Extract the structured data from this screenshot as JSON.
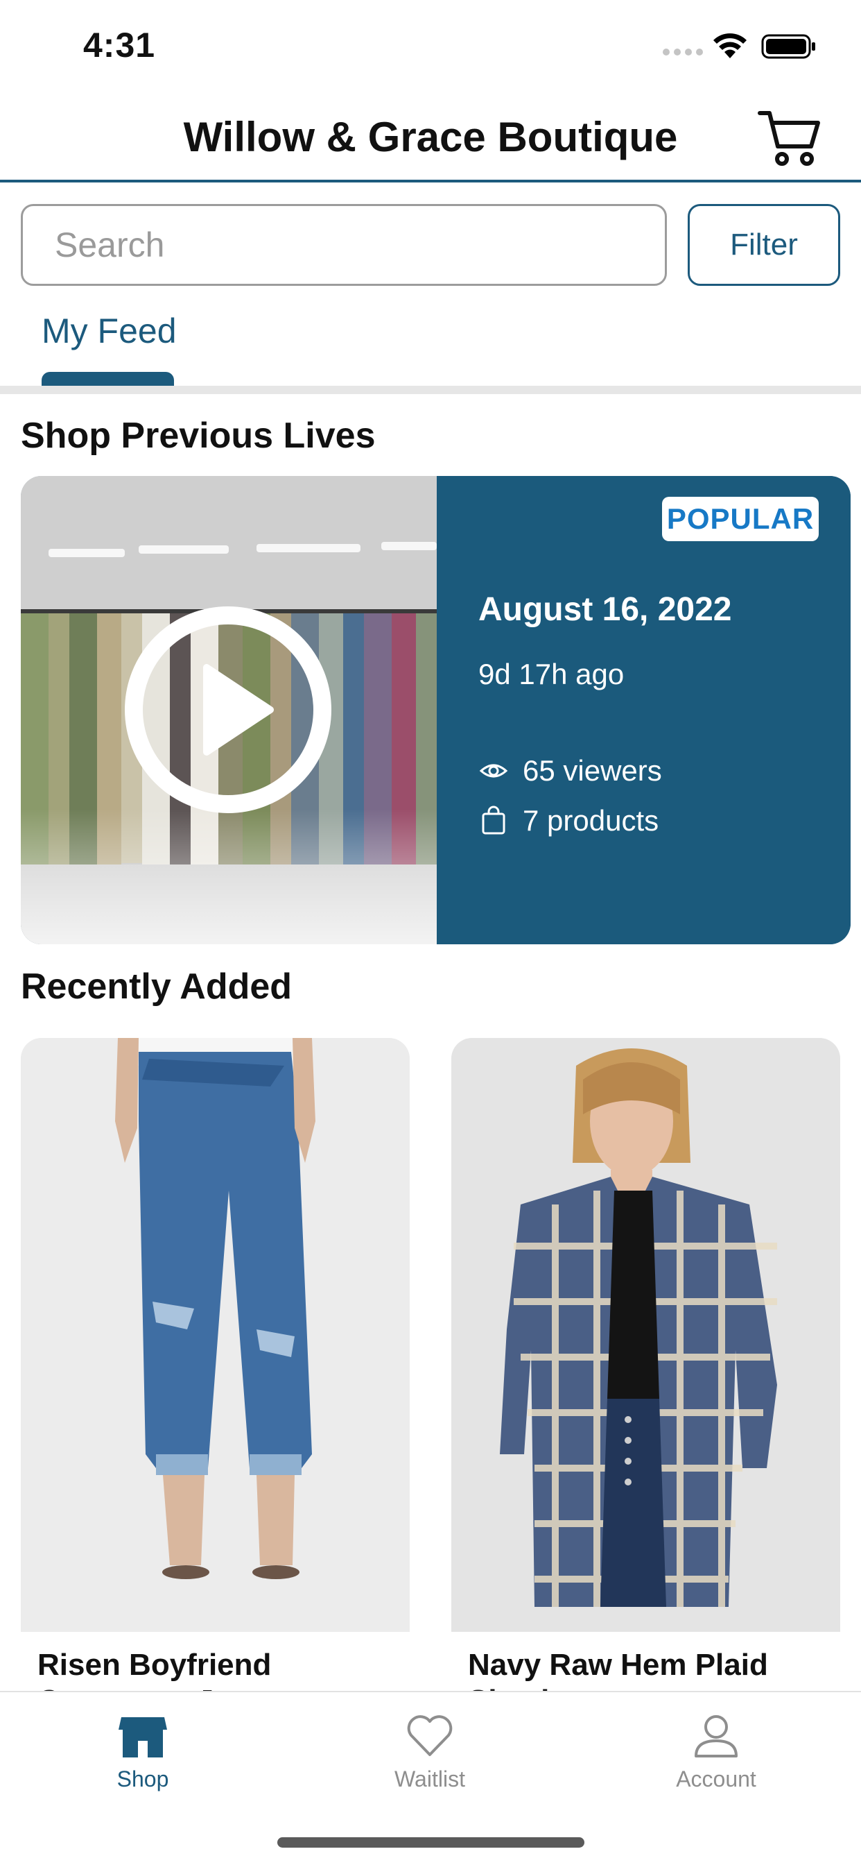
{
  "status_bar": {
    "time": "4:31"
  },
  "header": {
    "title": "Willow & Grace Boutique",
    "cart_icon": "cart-icon"
  },
  "search": {
    "placeholder": "Search",
    "filter_label": "Filter"
  },
  "tabs": [
    {
      "label": "My Feed",
      "active": true
    }
  ],
  "previous_lives": {
    "section_title": "Shop Previous Lives",
    "card": {
      "badge": "POPULAR",
      "date": "August 16, 2022",
      "ago": "9d 17h ago",
      "viewers": "65 viewers",
      "products": "7 products"
    }
  },
  "recently_added": {
    "section_title": "Recently Added",
    "products": [
      {
        "name": "Risen Boyfriend Crossover Jeans"
      },
      {
        "name": "Navy Raw Hem Plaid Shacket"
      }
    ]
  },
  "tab_bar": {
    "items": [
      {
        "label": "Shop",
        "icon": "store-icon",
        "active": true
      },
      {
        "label": "Waitlist",
        "icon": "heart-icon",
        "active": false
      },
      {
        "label": "Account",
        "icon": "person-icon",
        "active": false
      }
    ]
  },
  "colors": {
    "primary": "#1c5a7d",
    "badge_text": "#1779c6",
    "inactive_tab": "#8e8e8e",
    "divider": "#e6e6e6"
  }
}
